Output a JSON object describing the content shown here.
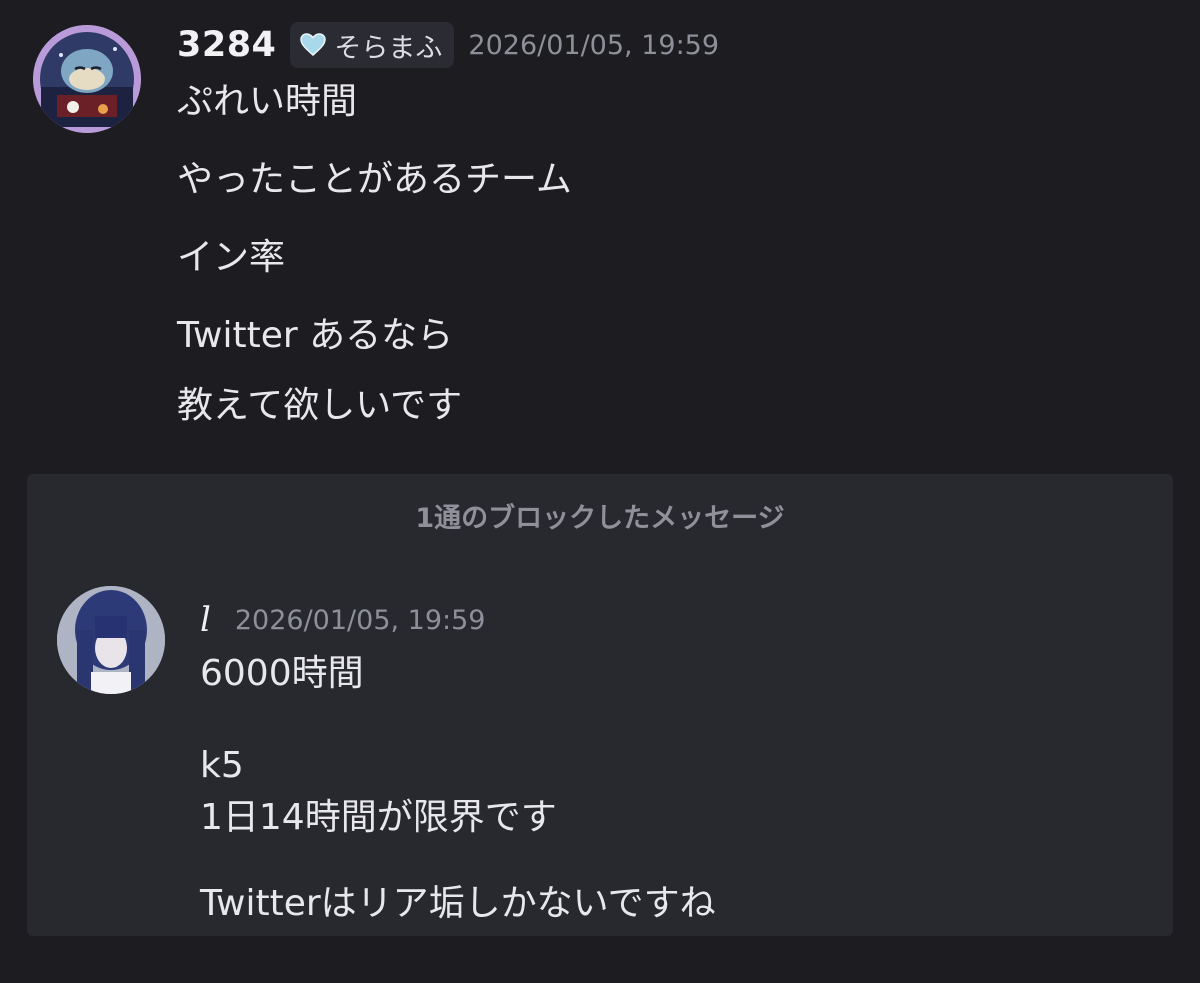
{
  "message1": {
    "username": "3284",
    "tag_icon": "heart-icon",
    "tag_label": "そらまふ",
    "timestamp": "2026/01/05, 19:59",
    "lines": [
      "ぷれい時間",
      "やったことがあるチーム",
      "イン率",
      "Twitter あるなら",
      "教えて欲しいです"
    ]
  },
  "blocked": {
    "title": "1通のブロックしたメッセージ",
    "message": {
      "username": "l",
      "timestamp": "2026/01/05, 19:59",
      "lines": [
        "6000時間",
        "k5",
        "1日14時間が限界です",
        "Twitterはリア垢しかないですね"
      ]
    }
  },
  "colors": {
    "background": "#1c1c21",
    "blocked_background": "#28292e",
    "tag_background": "#2b2c33",
    "muted_text": "#8e9099",
    "heart": "#9fd3e6"
  }
}
